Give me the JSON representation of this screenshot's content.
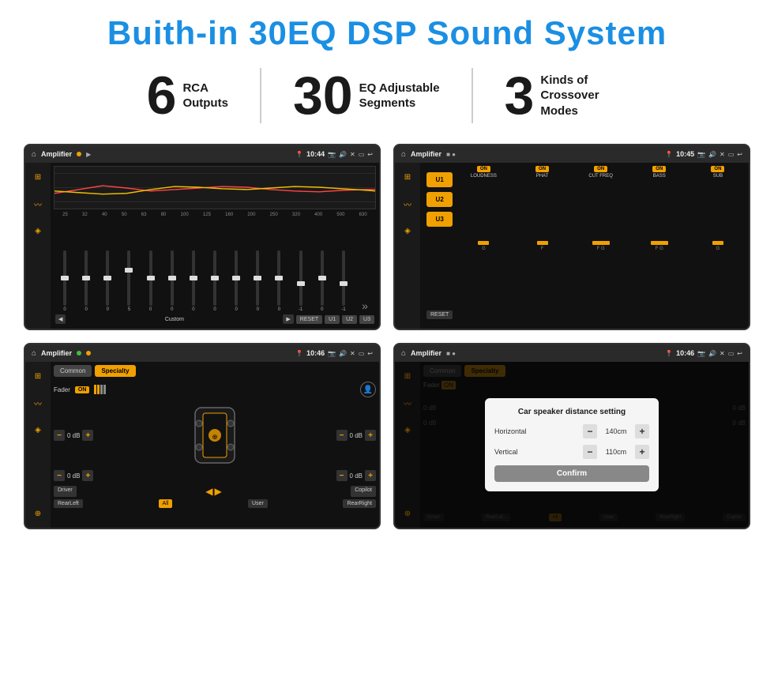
{
  "header": {
    "title": "Buith-in 30EQ DSP Sound System"
  },
  "stats": [
    {
      "number": "6",
      "text": "RCA\nOutputs"
    },
    {
      "number": "30",
      "text": "EQ Adjustable\nSegments"
    },
    {
      "number": "3",
      "text": "Kinds of\nCrossover Modes"
    }
  ],
  "screens": [
    {
      "id": "screen1",
      "statusbar": {
        "title": "Amplifier",
        "time": "10:44"
      },
      "type": "eq",
      "freqs": [
        "25",
        "32",
        "40",
        "50",
        "63",
        "80",
        "100",
        "125",
        "160",
        "200",
        "250",
        "320",
        "400",
        "500",
        "630"
      ],
      "values": [
        "0",
        "0",
        "0",
        "5",
        "0",
        "0",
        "0",
        "0",
        "0",
        "0",
        "0",
        "-1",
        "0",
        "-1"
      ],
      "preset": "Custom",
      "buttons": [
        "RESET",
        "U1",
        "U2",
        "U3"
      ]
    },
    {
      "id": "screen2",
      "statusbar": {
        "title": "Amplifier",
        "time": "10:45"
      },
      "type": "amplifier",
      "uButtons": [
        "U1",
        "U2",
        "U3"
      ],
      "channels": [
        "LOUDNESS",
        "PHAT",
        "CUT FREQ",
        "BASS",
        "SUB"
      ],
      "onStates": [
        true,
        true,
        true,
        true,
        true
      ]
    },
    {
      "id": "screen3",
      "statusbar": {
        "title": "Amplifier",
        "time": "10:46"
      },
      "type": "specialty",
      "tabs": [
        "Common",
        "Specialty"
      ],
      "activeTab": 1,
      "faderLabel": "Fader",
      "faderOn": true,
      "channels": [
        {
          "label": "0 dB"
        },
        {
          "label": "0 dB"
        },
        {
          "label": "0 dB"
        },
        {
          "label": "0 dB"
        }
      ],
      "bottomLabels": [
        "Driver",
        "RearLeft",
        "All",
        "User",
        "RearRight",
        "Copilot"
      ]
    },
    {
      "id": "screen4",
      "statusbar": {
        "title": "Amplifier",
        "time": "10:46"
      },
      "type": "dialog",
      "tabs": [
        "Common",
        "Specialty"
      ],
      "dialogTitle": "Car speaker distance setting",
      "fields": [
        {
          "label": "Horizontal",
          "value": "140cm"
        },
        {
          "label": "Vertical",
          "value": "110cm"
        }
      ],
      "confirmLabel": "Confirm",
      "bottomLabels": [
        "Driver",
        "RearLef...",
        "All",
        "User",
        "RearRight",
        "Copilot"
      ]
    }
  ]
}
